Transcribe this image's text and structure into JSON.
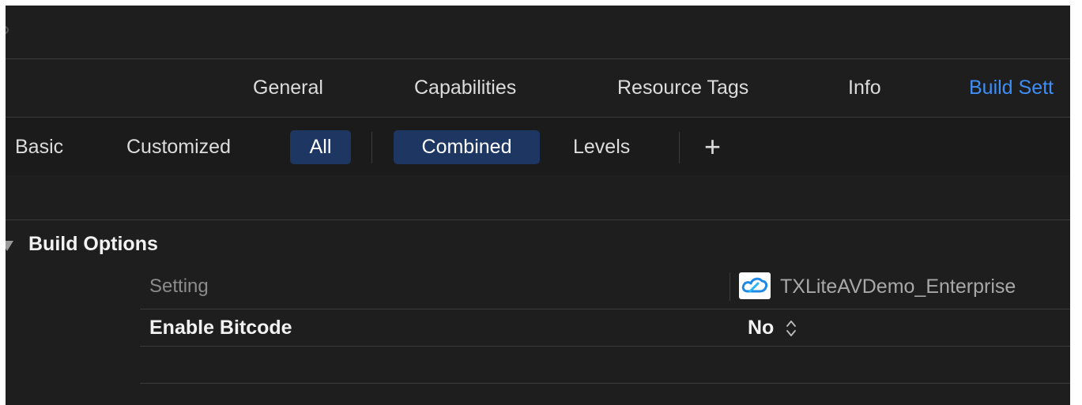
{
  "tabs": {
    "general": "General",
    "capabilities": "Capabilities",
    "resource_tags": "Resource Tags",
    "info": "Info",
    "build_settings": "Build Sett"
  },
  "filters": {
    "basic": "Basic",
    "customized": "Customized",
    "all": "All",
    "combined": "Combined",
    "levels": "Levels",
    "add": "+"
  },
  "section": {
    "title": "Build Options"
  },
  "table": {
    "header_setting": "Setting",
    "target_name": "TXLiteAVDemo_Enterprise",
    "target_icon": "cloud-app-icon",
    "rows": [
      {
        "name": "Enable Bitcode",
        "value": "No"
      }
    ]
  },
  "colors": {
    "accent": "#3d8ef7",
    "selected_segment": "#1d3762",
    "background": "#1e1e1e"
  }
}
